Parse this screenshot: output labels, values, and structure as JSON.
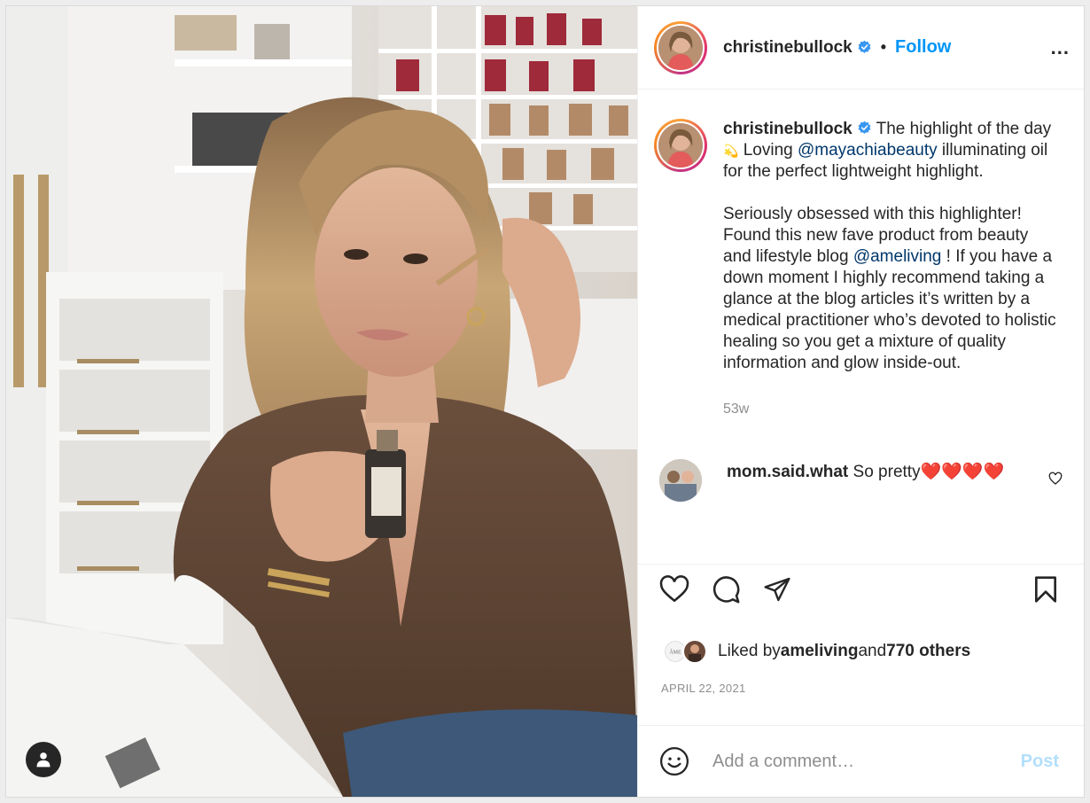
{
  "post": {
    "username": "christinebullock",
    "follow_label": "Follow",
    "dot": "•",
    "more_label": "..."
  },
  "caption": {
    "username": "christinebullock",
    "text_1": " The highlight of the day ",
    "sparkle": "💫",
    "text_2": " Loving ",
    "mention_1": "@mayachiabeauty",
    "text_3": " illuminating oil for the perfect lightweight highlight.",
    "text_4": "Seriously obsessed with this highlighter! Found this new fave product from beauty and lifestyle blog ",
    "mention_2": "@ameliving",
    "text_5": " ! If you have a down moment I highly recommend taking a glance at the blog articles it’s written by a medical practitioner who’s devoted to holistic healing so you get a mixture of quality information and glow inside-out.",
    "time": "53w"
  },
  "comments": [
    {
      "username": "mom.said.what",
      "text": " So pretty❤️❤️❤️❤️"
    }
  ],
  "likes": {
    "prefix": "Liked by ",
    "user": "ameliving",
    "middle": " and ",
    "others": "770 others",
    "mini_logo_text": "ÂME"
  },
  "date": "APRIL 22, 2021",
  "add_comment": {
    "placeholder": "Add a comment…",
    "post_label": "Post"
  },
  "icons": {
    "tag": "person-tag-icon",
    "like": "heart-icon",
    "comment": "comment-bubble-icon",
    "share": "paper-plane-icon",
    "save": "bookmark-icon",
    "emoji": "smiley-icon",
    "verified": "verified-badge-icon"
  },
  "colors": {
    "accent": "#0095f6",
    "mention": "#00376b",
    "muted": "#8e8e8e",
    "post_disabled": "#b2dffc"
  }
}
